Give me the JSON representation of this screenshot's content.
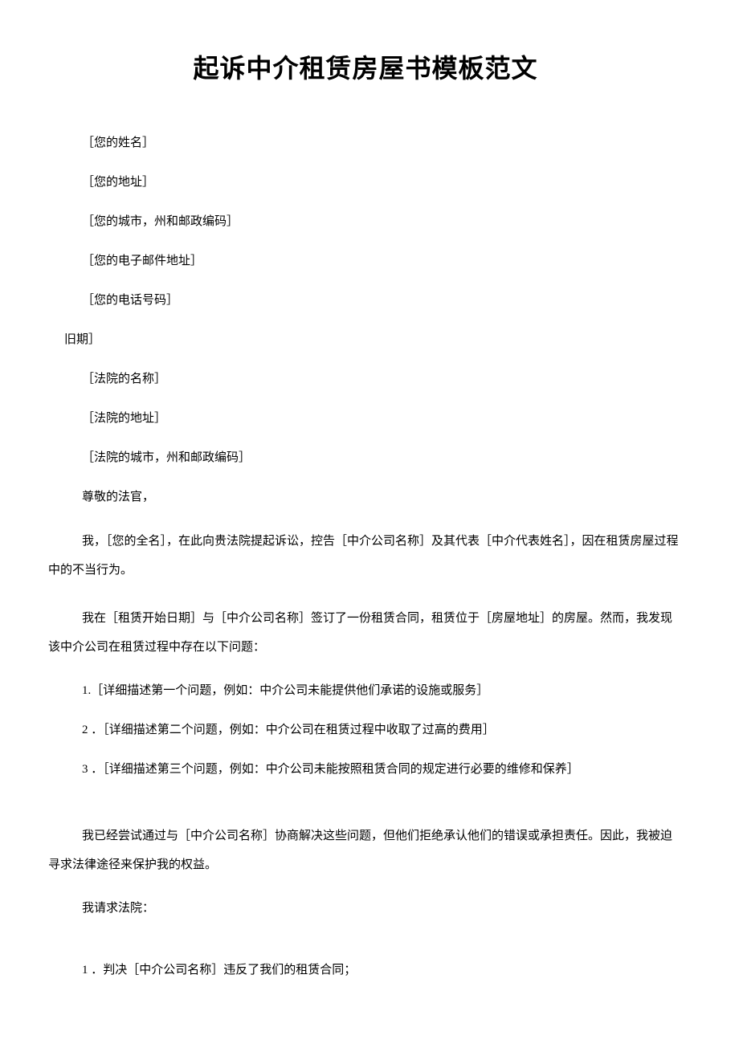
{
  "title": "起诉中介租赁房屋书模板范文",
  "fields": {
    "name": "［您的姓名］",
    "address": "［您的地址］",
    "cityStateZip": "［您的城市，州和邮政编码］",
    "email": "［您的电子邮件地址］",
    "phone": "［您的电话号码］",
    "date": "旧期］",
    "courtName": "［法院的名称］",
    "courtAddress": "［法院的地址］",
    "courtCityStateZip": "［法院的城市，州和邮政编码］"
  },
  "salutation": "尊敬的法官，",
  "intro": "我，［您的全名］，在此向贵法院提起诉讼，控告［中介公司名称］及其代表［中介代表姓名］，因在租赁房屋过程中的不当行为。",
  "background": "我在［租赁开始日期］与［中介公司名称］签订了一份租赁合同，租赁位于［房屋地址］的房屋。然而，我发现该中介公司在租赁过程中存在以下问题：",
  "issues": [
    "1.［详细描述第一个问题，例如：中介公司未能提供他们承诺的设施或服务］",
    "2 ．［详细描述第二个问题，例如：中介公司在租赁过程中收取了过高的费用］",
    "3 ．［详细描述第三个问题，例如：中介公司未能按照租赁合同的规定进行必要的维修和保养］"
  ],
  "attempt": "我已经尝试通过与［中介公司名称］协商解决这些问题，但他们拒绝承认他们的错误或承担责任。因此，我被迫寻求法律途径来保护我的权益。",
  "requestIntro": "我请求法院：",
  "requests": [
    "1 ．判决［中介公司名称］违反了我们的租赁合同；"
  ]
}
